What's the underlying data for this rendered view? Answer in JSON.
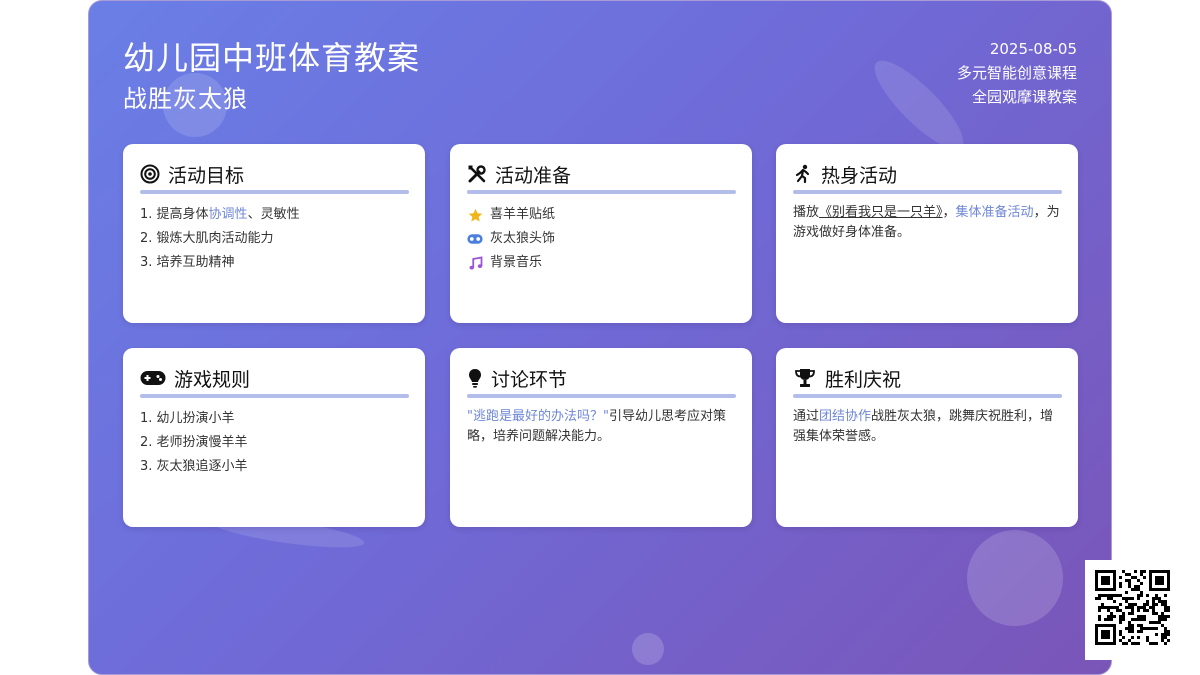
{
  "header": {
    "title": "幼儿园中班体育教案",
    "subtitle": "战胜灰太狼",
    "date": "2025-08-05",
    "meta_line1": "多元智能创意课程",
    "meta_line2": "全园观摩课教案"
  },
  "cards": {
    "goals": {
      "title": "活动目标",
      "icon": "target-icon",
      "item1_prefix": "1. 提高身体",
      "item1_hl": "协调性",
      "item1_suffix": "、灵敏性",
      "item2": "2. 锻炼大肌肉活动能力",
      "item3": "3. 培养互助精神"
    },
    "prep": {
      "title": "活动准备",
      "icon": "tools-icon",
      "items": [
        "喜羊羊贴纸",
        "灰太狼头饰",
        "背景音乐"
      ]
    },
    "warmup": {
      "title": "热身活动",
      "icon": "running-icon",
      "text_prefix": "播放",
      "song": "《别看我只是一只羊》",
      "comma": "，",
      "hl": "集体准备活动",
      "text_suffix": "，为游戏做好身体准备。"
    },
    "rules": {
      "title": "游戏规则",
      "icon": "gamepad-icon",
      "item1": "1. 幼儿扮演小羊",
      "item2": "2. 老师扮演慢羊羊",
      "item3": "3. 灰太狼追逐小羊"
    },
    "discussion": {
      "title": "讨论环节",
      "icon": "lightbulb-icon",
      "hl": "\"逃跑是最好的办法吗？\"",
      "text": "引导幼儿思考应对策略，培养问题解决能力。"
    },
    "celebration": {
      "title": "胜利庆祝",
      "icon": "trophy-icon",
      "prefix": "通过",
      "hl": "团结协作",
      "text": "战胜灰太狼，跳舞庆祝胜利，增强集体荣誉感。"
    }
  },
  "colors": {
    "accent": "#6e86d6",
    "bar": "#b3bde9",
    "bg_start": "#6a7fe6",
    "bg_end": "#7a55b8"
  }
}
